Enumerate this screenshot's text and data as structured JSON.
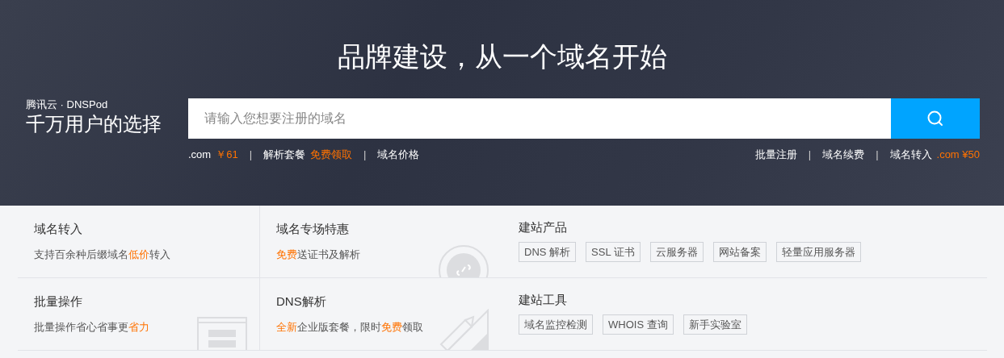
{
  "hero": {
    "title": "品牌建设，从一个域名开始",
    "brand": "腾讯云 · DNSPod",
    "slogan": "千万用户的选择",
    "search": {
      "placeholder": "请输入您想要注册的域名"
    },
    "separator": "|",
    "left_links": [
      {
        "parts": [
          {
            "text": ".com",
            "highlight": false
          },
          {
            "text": "￥61",
            "highlight": true
          }
        ]
      },
      {
        "parts": [
          {
            "text": "解析套餐",
            "highlight": false
          },
          {
            "text": "免费领取",
            "highlight": true
          }
        ]
      },
      {
        "parts": [
          {
            "text": "域名价格",
            "highlight": false
          }
        ]
      }
    ],
    "right_links": [
      {
        "parts": [
          {
            "text": "批量注册",
            "highlight": false
          }
        ]
      },
      {
        "parts": [
          {
            "text": "域名续费",
            "highlight": false
          }
        ]
      },
      {
        "parts": [
          {
            "text": "域名转入",
            "highlight": false
          },
          {
            "text": ".com ¥50",
            "highlight": true
          }
        ]
      }
    ]
  },
  "features": [
    {
      "title": "域名转入",
      "desc": [
        {
          "text": "支持百余种后缀域名",
          "highlight": false
        },
        {
          "text": "低价",
          "highlight": true
        },
        {
          "text": "转入",
          "highlight": false
        }
      ]
    },
    {
      "title": "域名专场特惠",
      "kind": "circle",
      "desc": [
        {
          "text": "免费",
          "highlight": true
        },
        {
          "text": "送证书及解析",
          "highlight": false
        }
      ]
    },
    {
      "title": "批量操作",
      "kind": "window",
      "desc": [
        {
          "text": "批量操作省心省事更",
          "highlight": false
        },
        {
          "text": "省力",
          "highlight": true
        }
      ]
    },
    {
      "title": "DNS解析",
      "kind": "pencil",
      "desc": [
        {
          "text": "全新",
          "highlight": true
        },
        {
          "text": "企业版套餐，限时",
          "highlight": false
        },
        {
          "text": "免费",
          "highlight": true
        },
        {
          "text": "领取",
          "highlight": false
        }
      ]
    }
  ],
  "tag_groups": [
    {
      "title": "建站产品",
      "tags": [
        "DNS 解析",
        "SSL 证书",
        "云服务器",
        "网站备案",
        "轻量应用服务器"
      ]
    },
    {
      "title": "建站工具",
      "tags": [
        "域名监控检测",
        "WHOIS 查询",
        "新手实验室"
      ]
    }
  ]
}
